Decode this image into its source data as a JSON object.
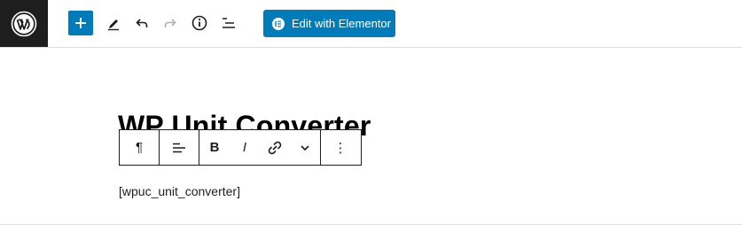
{
  "header": {
    "elementor_button_label": "Edit with Elementor",
    "icons": {
      "logo": "wordpress-logo-icon",
      "add": "plus-icon",
      "tools": "pencil-icon",
      "undo": "undo-icon",
      "redo": "redo-icon",
      "details": "info-icon",
      "outline": "list-view-icon",
      "elementor": "elementor-logo-icon"
    }
  },
  "content": {
    "title": "WP Unit Converter",
    "shortcode": "[wpuc_unit_converter]"
  },
  "block_toolbar": {
    "paragraph_glyph": "¶",
    "bold_label": "B",
    "italic_label": "I",
    "more_glyph": "⋮"
  },
  "colors": {
    "accent": "#007cba",
    "logo_bg": "#1e1e1e",
    "text": "#1e1e1e"
  }
}
